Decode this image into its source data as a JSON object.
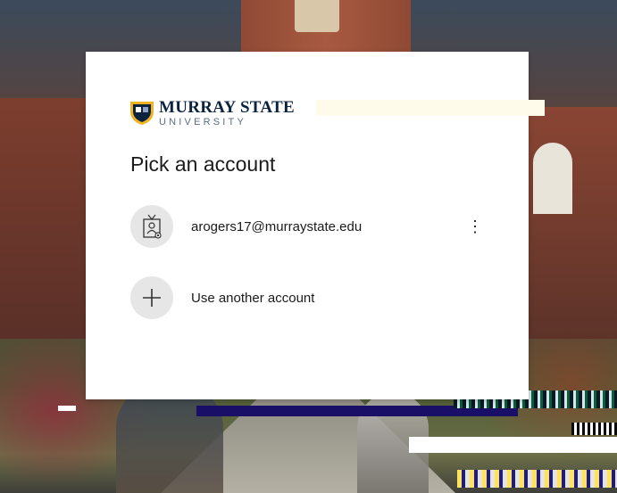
{
  "logo": {
    "main": "MURRAY STATE",
    "sub": "UNIVERSITY",
    "icon": "shield-logo-icon"
  },
  "title": "Pick an account",
  "accounts": [
    {
      "label": "arogers17@murraystate.edu",
      "icon": "user-badge-icon",
      "more": "⋮"
    },
    {
      "label": "Use another account",
      "icon": "plus-icon"
    }
  ],
  "colors": {
    "brand_navy": "#0c2340",
    "brand_gold": "#f0b323",
    "avatar_bg": "#e6e6e6"
  }
}
